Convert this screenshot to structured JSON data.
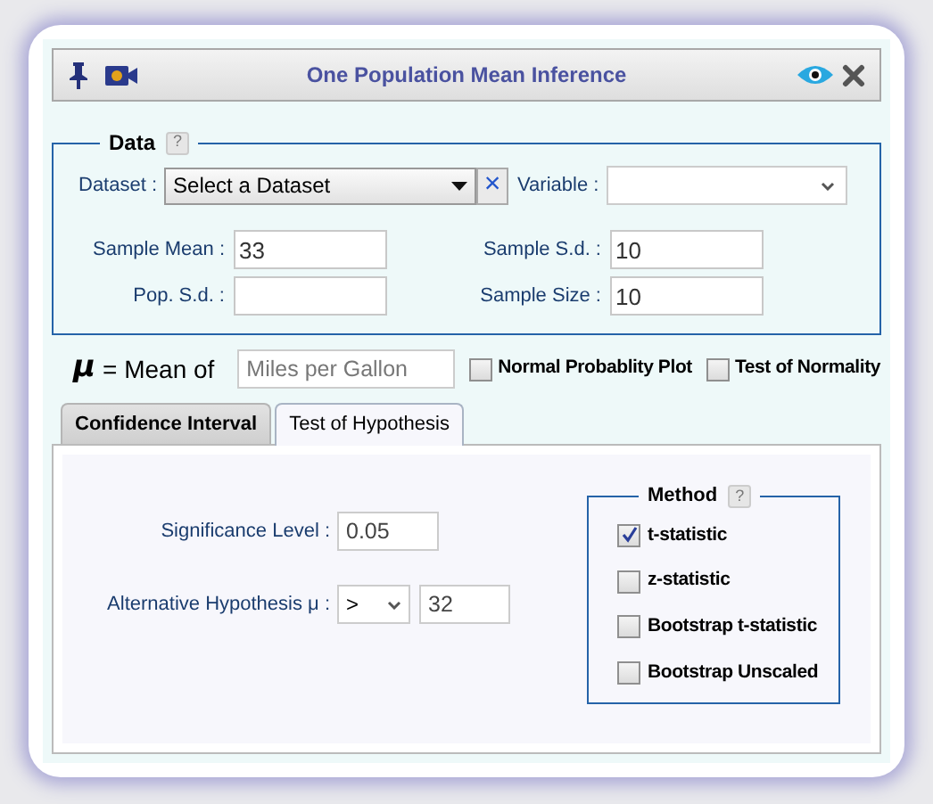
{
  "window": {
    "title": "One Population Mean Inference"
  },
  "data": {
    "legend": "Data",
    "help": "?",
    "dataset_label": "Dataset :",
    "dataset_value": "Select a Dataset",
    "clear": "×",
    "variable_label": "Variable :",
    "fields": [
      {
        "label": "Sample Mean :",
        "value": "33"
      },
      {
        "label": "Sample S.d. :",
        "value": "10"
      },
      {
        "label": "Pop. S.d. :"
      },
      {
        "label": "Sample Size :",
        "value": "10"
      }
    ]
  },
  "mean_of": {
    "symbol": "μ",
    "label": "= Mean of",
    "placeholder": "Miles per Gallon"
  },
  "options": [
    {
      "label": "Normal Probablity Plot",
      "checked": false
    },
    {
      "label": "Test of Normality",
      "checked": false
    }
  ],
  "tabs": [
    {
      "label": "Confidence Interval",
      "selected": false
    },
    {
      "label": "Test of Hypothesis",
      "selected": true
    }
  ],
  "significance": {
    "label": "Significance Level :",
    "value": "0.05"
  },
  "alternative": {
    "label": "Alternative Hypothesis μ :",
    "operator": ">",
    "value": "32"
  },
  "method": {
    "legend": "Method",
    "help": "?",
    "items": [
      {
        "label": "t-statistic",
        "checked": true
      },
      {
        "label": "z-statistic",
        "checked": false
      },
      {
        "label": "Bootstrap t-statistic",
        "checked": false
      },
      {
        "label": "Bootstrap Unscaled",
        "checked": false
      }
    ]
  }
}
